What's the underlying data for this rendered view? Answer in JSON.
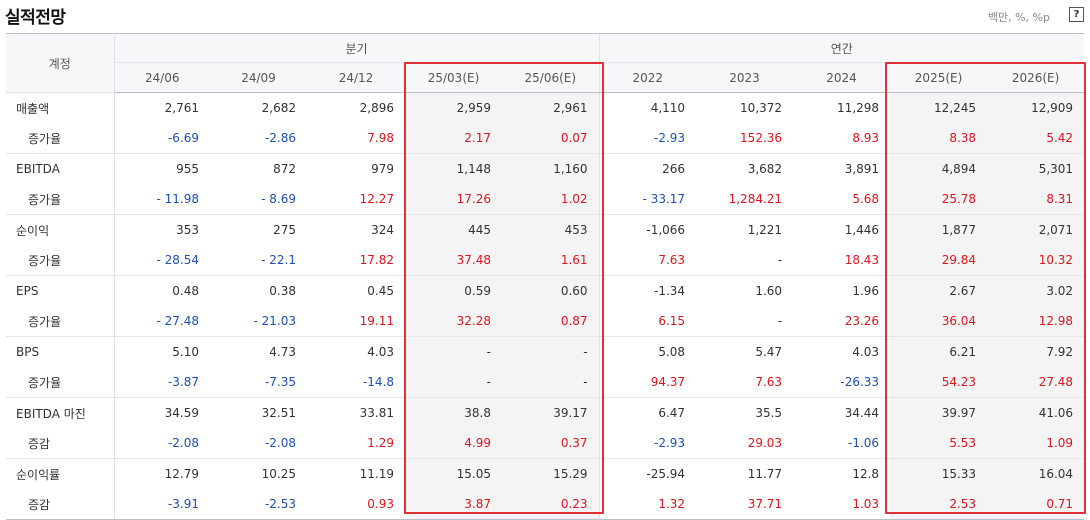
{
  "header": {
    "title": "실적전망",
    "unit": "백만, %, %p",
    "help": "?"
  },
  "columns": {
    "account": "계정",
    "groups": [
      "분기",
      "연간"
    ],
    "periods": [
      "24/06",
      "24/09",
      "24/12",
      "25/03(E)",
      "25/06(E)",
      "2022",
      "2023",
      "2024",
      "2025(E)",
      "2026(E)"
    ]
  },
  "rows": [
    {
      "label": "매출액",
      "values": [
        "2,761",
        "2,682",
        "2,896",
        "2,959",
        "2,961",
        "4,110",
        "10,372",
        "11,298",
        "12,245",
        "12,909"
      ],
      "sub_label": "증가율",
      "sub_values": [
        "-6.69",
        "-2.86",
        "7.98",
        "2.17",
        "0.07",
        "-2.93",
        "152.36",
        "8.93",
        "8.38",
        "5.42"
      ]
    },
    {
      "label": "EBITDA",
      "values": [
        "955",
        "872",
        "979",
        "1,148",
        "1,160",
        "266",
        "3,682",
        "3,891",
        "4,894",
        "5,301"
      ],
      "sub_label": "증가율",
      "sub_values": [
        "- 11.98",
        "- 8.69",
        "12.27",
        "17.26",
        "1.02",
        "- 33.17",
        "1,284.21",
        "5.68",
        "25.78",
        "8.31"
      ]
    },
    {
      "label": "순이익",
      "values": [
        "353",
        "275",
        "324",
        "445",
        "453",
        "-1,066",
        "1,221",
        "1,446",
        "1,877",
        "2,071"
      ],
      "sub_label": "증가율",
      "sub_values": [
        "- 28.54",
        "- 22.1",
        "17.82",
        "37.48",
        "1.61",
        "7.63",
        "-",
        "18.43",
        "29.84",
        "10.32"
      ]
    },
    {
      "label": "EPS",
      "values": [
        "0.48",
        "0.38",
        "0.45",
        "0.59",
        "0.60",
        "-1.34",
        "1.60",
        "1.96",
        "2.67",
        "3.02"
      ],
      "sub_label": "증가율",
      "sub_values": [
        "- 27.48",
        "- 21.03",
        "19.11",
        "32.28",
        "0.87",
        "6.15",
        "-",
        "23.26",
        "36.04",
        "12.98"
      ]
    },
    {
      "label": "BPS",
      "values": [
        "5.10",
        "4.73",
        "4.03",
        "-",
        "-",
        "5.08",
        "5.47",
        "4.03",
        "6.21",
        "7.92"
      ],
      "sub_label": "증가율",
      "sub_values": [
        "-3.87",
        "-7.35",
        "-14.8",
        "-",
        "-",
        "94.37",
        "7.63",
        "-26.33",
        "54.23",
        "27.48"
      ]
    },
    {
      "label": "EBITDA 마진",
      "values": [
        "34.59",
        "32.51",
        "33.81",
        "38.8",
        "39.17",
        "6.47",
        "35.5",
        "34.44",
        "39.97",
        "41.06"
      ],
      "sub_label": "증감",
      "sub_values": [
        "-2.08",
        "-2.08",
        "1.29",
        "4.99",
        "0.37",
        "-2.93",
        "29.03",
        "-1.06",
        "5.53",
        "1.09"
      ]
    },
    {
      "label": "순이익률",
      "values": [
        "12.79",
        "10.25",
        "11.19",
        "15.05",
        "15.29",
        "-25.94",
        "11.77",
        "12.8",
        "15.33",
        "16.04"
      ],
      "sub_label": "증감",
      "sub_values": [
        "-3.91",
        "-2.53",
        "0.93",
        "3.87",
        "0.23",
        "1.32",
        "37.71",
        "1.03",
        "2.53",
        "0.71"
      ]
    }
  ],
  "colors": {
    "positive": "#e0151b",
    "negative": "#1a51b8",
    "highlight": "#e0303a",
    "estimate_bg": "#f4f4f4"
  }
}
